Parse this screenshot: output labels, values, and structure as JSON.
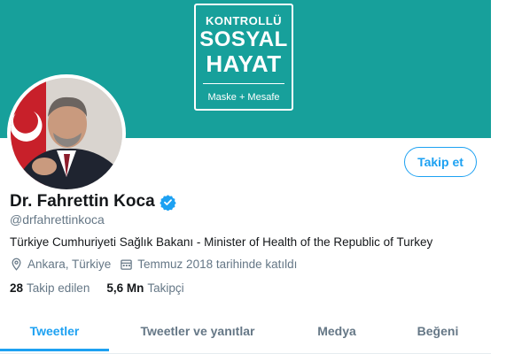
{
  "banner": {
    "logo_line1": "KONTROLLÜ",
    "logo_line2": "SOSYAL",
    "logo_line3": "HAYAT",
    "logo_line4": "Maske + Mesafe",
    "background_color": "#17a09b"
  },
  "profile": {
    "display_name": "Dr. Fahrettin Koca",
    "handle": "@drfahrettinkoca",
    "bio": "Türkiye Cumhuriyeti Sağlık Bakanı - Minister of Health of the Republic of Turkey",
    "location": "Ankara, Türkiye",
    "joined": "Temmuz 2018 tarihinde katıldı",
    "verified_icon": "verified-badge-icon",
    "location_icon": "location-pin-icon",
    "calendar_icon": "calendar-icon"
  },
  "actions": {
    "follow_label": "Takip et"
  },
  "stats": {
    "following_count": "28",
    "following_label": "Takip edilen",
    "followers_count": "5,6 Mn",
    "followers_label": "Takipçi"
  },
  "tabs": [
    {
      "label": "Tweetler",
      "active": true
    },
    {
      "label": "Tweetler ve yanıtlar",
      "active": false
    },
    {
      "label": "Medya",
      "active": false
    },
    {
      "label": "Beğeni",
      "active": false
    }
  ],
  "colors": {
    "accent": "#1da1f2",
    "secondary_text": "#657786"
  }
}
